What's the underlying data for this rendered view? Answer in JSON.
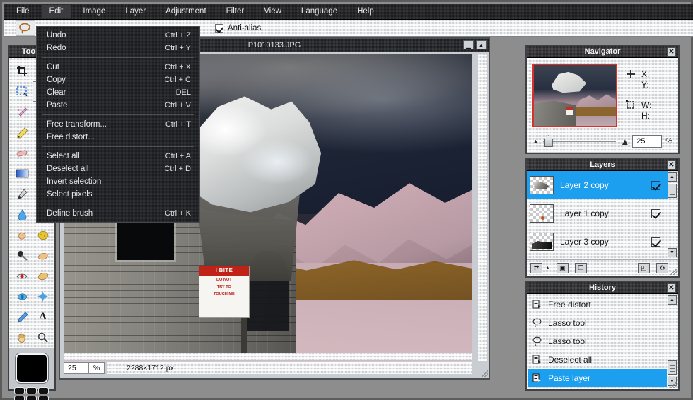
{
  "app": {
    "accent_selection": "#1d9ff0",
    "menubar_bg": "#1d1d20"
  },
  "menubar": {
    "items": [
      {
        "label": "File",
        "active": false
      },
      {
        "label": "Edit",
        "active": true
      },
      {
        "label": "Image",
        "active": false
      },
      {
        "label": "Layer",
        "active": false
      },
      {
        "label": "Adjustment",
        "active": false
      },
      {
        "label": "Filter",
        "active": false
      },
      {
        "label": "View",
        "active": false
      },
      {
        "label": "Language",
        "active": false
      },
      {
        "label": "Help",
        "active": false
      }
    ]
  },
  "options_bar": {
    "tool_icon": "lasso-icon",
    "antialias_label": "Anti-alias",
    "antialias_checked": true
  },
  "edit_menu": {
    "groups": [
      [
        {
          "label": "Undo",
          "shortcut": "Ctrl + Z"
        },
        {
          "label": "Redo",
          "shortcut": "Ctrl + Y"
        }
      ],
      [
        {
          "label": "Cut",
          "shortcut": "Ctrl + X"
        },
        {
          "label": "Copy",
          "shortcut": "Ctrl + C"
        },
        {
          "label": "Clear",
          "shortcut": "DEL"
        },
        {
          "label": "Paste",
          "shortcut": "Ctrl + V"
        }
      ],
      [
        {
          "label": "Free transform...",
          "shortcut": "Ctrl + T"
        },
        {
          "label": "Free distort...",
          "shortcut": ""
        }
      ],
      [
        {
          "label": "Select all",
          "shortcut": "Ctrl + A"
        },
        {
          "label": "Deselect all",
          "shortcut": "Ctrl + D"
        },
        {
          "label": "Invert selection",
          "shortcut": ""
        },
        {
          "label": "Select pixels",
          "shortcut": ""
        }
      ],
      [
        {
          "label": "Define brush",
          "shortcut": "Ctrl + K"
        }
      ]
    ]
  },
  "tools_panel": {
    "title": "Tools",
    "close_label": "✕",
    "tools": [
      {
        "name": "crop-tool",
        "glyph": "⌗",
        "selected": false
      },
      {
        "name": "move-tool",
        "glyph": "▶",
        "selected": false
      },
      {
        "name": "marquee-select-tool",
        "glyph": "⬚",
        "selected": false
      },
      {
        "name": "lasso-tool",
        "glyph": "⊂",
        "selected": true
      },
      {
        "name": "magic-wand-tool",
        "glyph": "✦",
        "selected": false
      },
      {
        "name": "type-mask-tool",
        "glyph": "◆",
        "selected": false
      },
      {
        "name": "pencil-tool",
        "glyph": "✎",
        "selected": false
      },
      {
        "name": "brush-tool",
        "glyph": "✒",
        "selected": false
      },
      {
        "name": "eraser-tool",
        "glyph": "▭",
        "selected": false
      },
      {
        "name": "clone-stamp-tool",
        "glyph": "⚙",
        "selected": false
      },
      {
        "name": "gradient-tool",
        "glyph": "■",
        "selected": false
      },
      {
        "name": "paint-bucket-tool",
        "glyph": "◑",
        "selected": false
      },
      {
        "name": "pen-tool",
        "glyph": "✑",
        "selected": false
      },
      {
        "name": "note-tool",
        "glyph": "▯",
        "selected": false
      },
      {
        "name": "blur-tool",
        "glyph": "●",
        "selected": false
      },
      {
        "name": "shape-tool",
        "glyph": "▣",
        "selected": false
      },
      {
        "name": "smudge-tool",
        "glyph": "☛",
        "selected": false
      },
      {
        "name": "sponge-tool",
        "glyph": "⬤",
        "selected": false
      },
      {
        "name": "dodge-tool",
        "glyph": "⚫",
        "selected": false
      },
      {
        "name": "burn-tool",
        "glyph": "✋",
        "selected": false
      },
      {
        "name": "red-eye-tool",
        "glyph": "◉",
        "selected": false
      },
      {
        "name": "pillow-tool",
        "glyph": "⬭",
        "selected": false
      },
      {
        "name": "bloat-tool",
        "glyph": "⬤",
        "selected": false
      },
      {
        "name": "pinch-tool",
        "glyph": "✦",
        "selected": false
      },
      {
        "name": "eyedropper-tool",
        "glyph": "╱",
        "selected": false
      },
      {
        "name": "text-tool",
        "glyph": "A",
        "selected": false
      },
      {
        "name": "hand-tool",
        "glyph": "✋",
        "selected": false
      },
      {
        "name": "zoom-tool",
        "glyph": "⚲",
        "selected": false
      }
    ],
    "foreground_color": "#000000",
    "swatch_count": 6
  },
  "document": {
    "title": "P1010133.JPG",
    "minimize_glyph": "▁",
    "maximize_glyph": "▲",
    "zoom_value": "25",
    "percent_label": "%",
    "dimensions": "2288×1712 px",
    "sign": {
      "headline": "I BITE",
      "line1": "DO NOT",
      "line2": "TRY TO",
      "line3": "TOUCH ME"
    }
  },
  "navigator": {
    "title": "Navigator",
    "close_label": "✕",
    "pos_icon": "crosshair-icon",
    "size_icon": "selection-bounds-icon",
    "x_label": "X:",
    "y_label": "Y:",
    "w_label": "W:",
    "h_label": "H:",
    "x_value": "",
    "y_value": "",
    "w_value": "",
    "h_value": "",
    "zoom_value": "25",
    "percent_label": "%",
    "zoom_out_icon": "small-mountain-icon",
    "zoom_in_icon": "large-mountain-icon"
  },
  "layers": {
    "title": "Layers",
    "close_label": "✕",
    "rows": [
      {
        "name": "Layer 2 copy",
        "visible": true,
        "selected": true,
        "thumb": "lt-a"
      },
      {
        "name": "Layer 1 copy",
        "visible": true,
        "selected": false,
        "thumb": "lt-b"
      },
      {
        "name": "Layer 3 copy",
        "visible": true,
        "selected": false,
        "thumb": "lt-c"
      }
    ],
    "toolbar": [
      {
        "name": "blend-mode-button",
        "glyph": "⇄"
      },
      {
        "name": "blend-mode-arrow",
        "glyph": "▲"
      },
      {
        "name": "add-mask-button",
        "glyph": "▣"
      },
      {
        "name": "new-layer-button",
        "glyph": "❐"
      },
      {
        "name": "duplicate-layer-button",
        "glyph": "◰"
      },
      {
        "name": "delete-layer-button",
        "glyph": "♻"
      }
    ],
    "scroll_up_glyph": "▲",
    "scroll_down_glyph": "▼"
  },
  "history": {
    "title": "History",
    "close_label": "✕",
    "rows": [
      {
        "label": "Free distort",
        "icon": "document-action-icon",
        "glyph": "☰",
        "selected": false
      },
      {
        "label": "Lasso tool",
        "icon": "lasso-icon",
        "glyph": "⊂",
        "selected": false
      },
      {
        "label": "Lasso tool",
        "icon": "lasso-icon",
        "glyph": "⊂",
        "selected": false
      },
      {
        "label": "Deselect all",
        "icon": "document-action-icon",
        "glyph": "☰",
        "selected": false
      },
      {
        "label": "Paste layer",
        "icon": "document-action-icon",
        "glyph": "☰",
        "selected": true
      }
    ],
    "scroll_up_glyph": "▲",
    "scroll_down_glyph": "▼"
  }
}
